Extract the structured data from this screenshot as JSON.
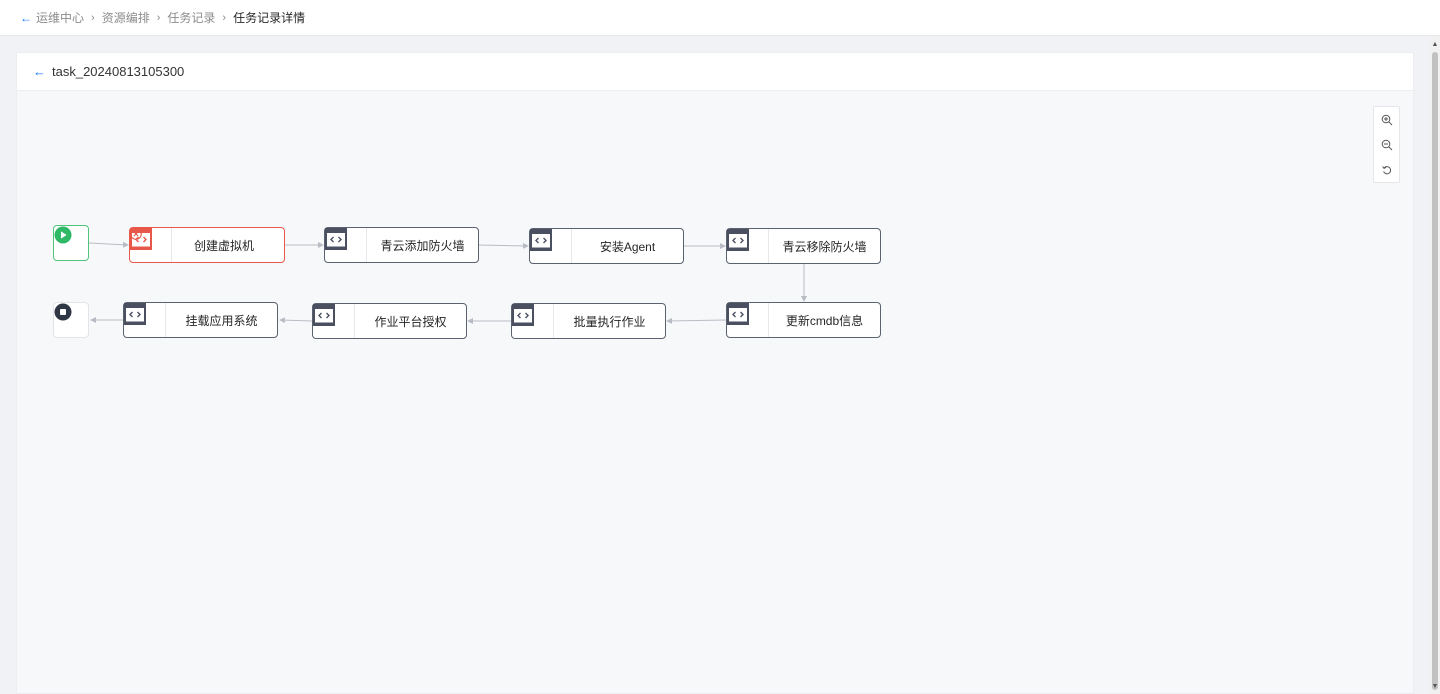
{
  "breadcrumb": {
    "items": [
      "运维中心",
      "资源编排",
      "任务记录"
    ],
    "current": "任务记录详情"
  },
  "task": {
    "title": "task_20240813105300"
  },
  "zoom": {
    "controls": [
      "zoom-in",
      "zoom-out",
      "reset"
    ]
  },
  "flow": {
    "start": {
      "icon": "play-icon"
    },
    "end": {
      "icon": "stop-icon"
    },
    "nodes": [
      {
        "label": "创建虚拟机",
        "status": "failed"
      },
      {
        "label": "青云添加防火墙",
        "status": "pending"
      },
      {
        "label": "安装Agent",
        "status": "pending"
      },
      {
        "label": "青云移除防火墙",
        "status": "pending"
      },
      {
        "label": "更新cmdb信息",
        "status": "pending"
      },
      {
        "label": "批量执行作业",
        "status": "pending"
      },
      {
        "label": "作业平台授权",
        "status": "pending"
      },
      {
        "label": "挂载应用系统",
        "status": "pending"
      }
    ]
  },
  "colors": {
    "accent": "#1677ff",
    "error": "#e8584a",
    "start": "#52c47a",
    "node_border": "#5a6270",
    "edge": "#b8bcc4"
  }
}
